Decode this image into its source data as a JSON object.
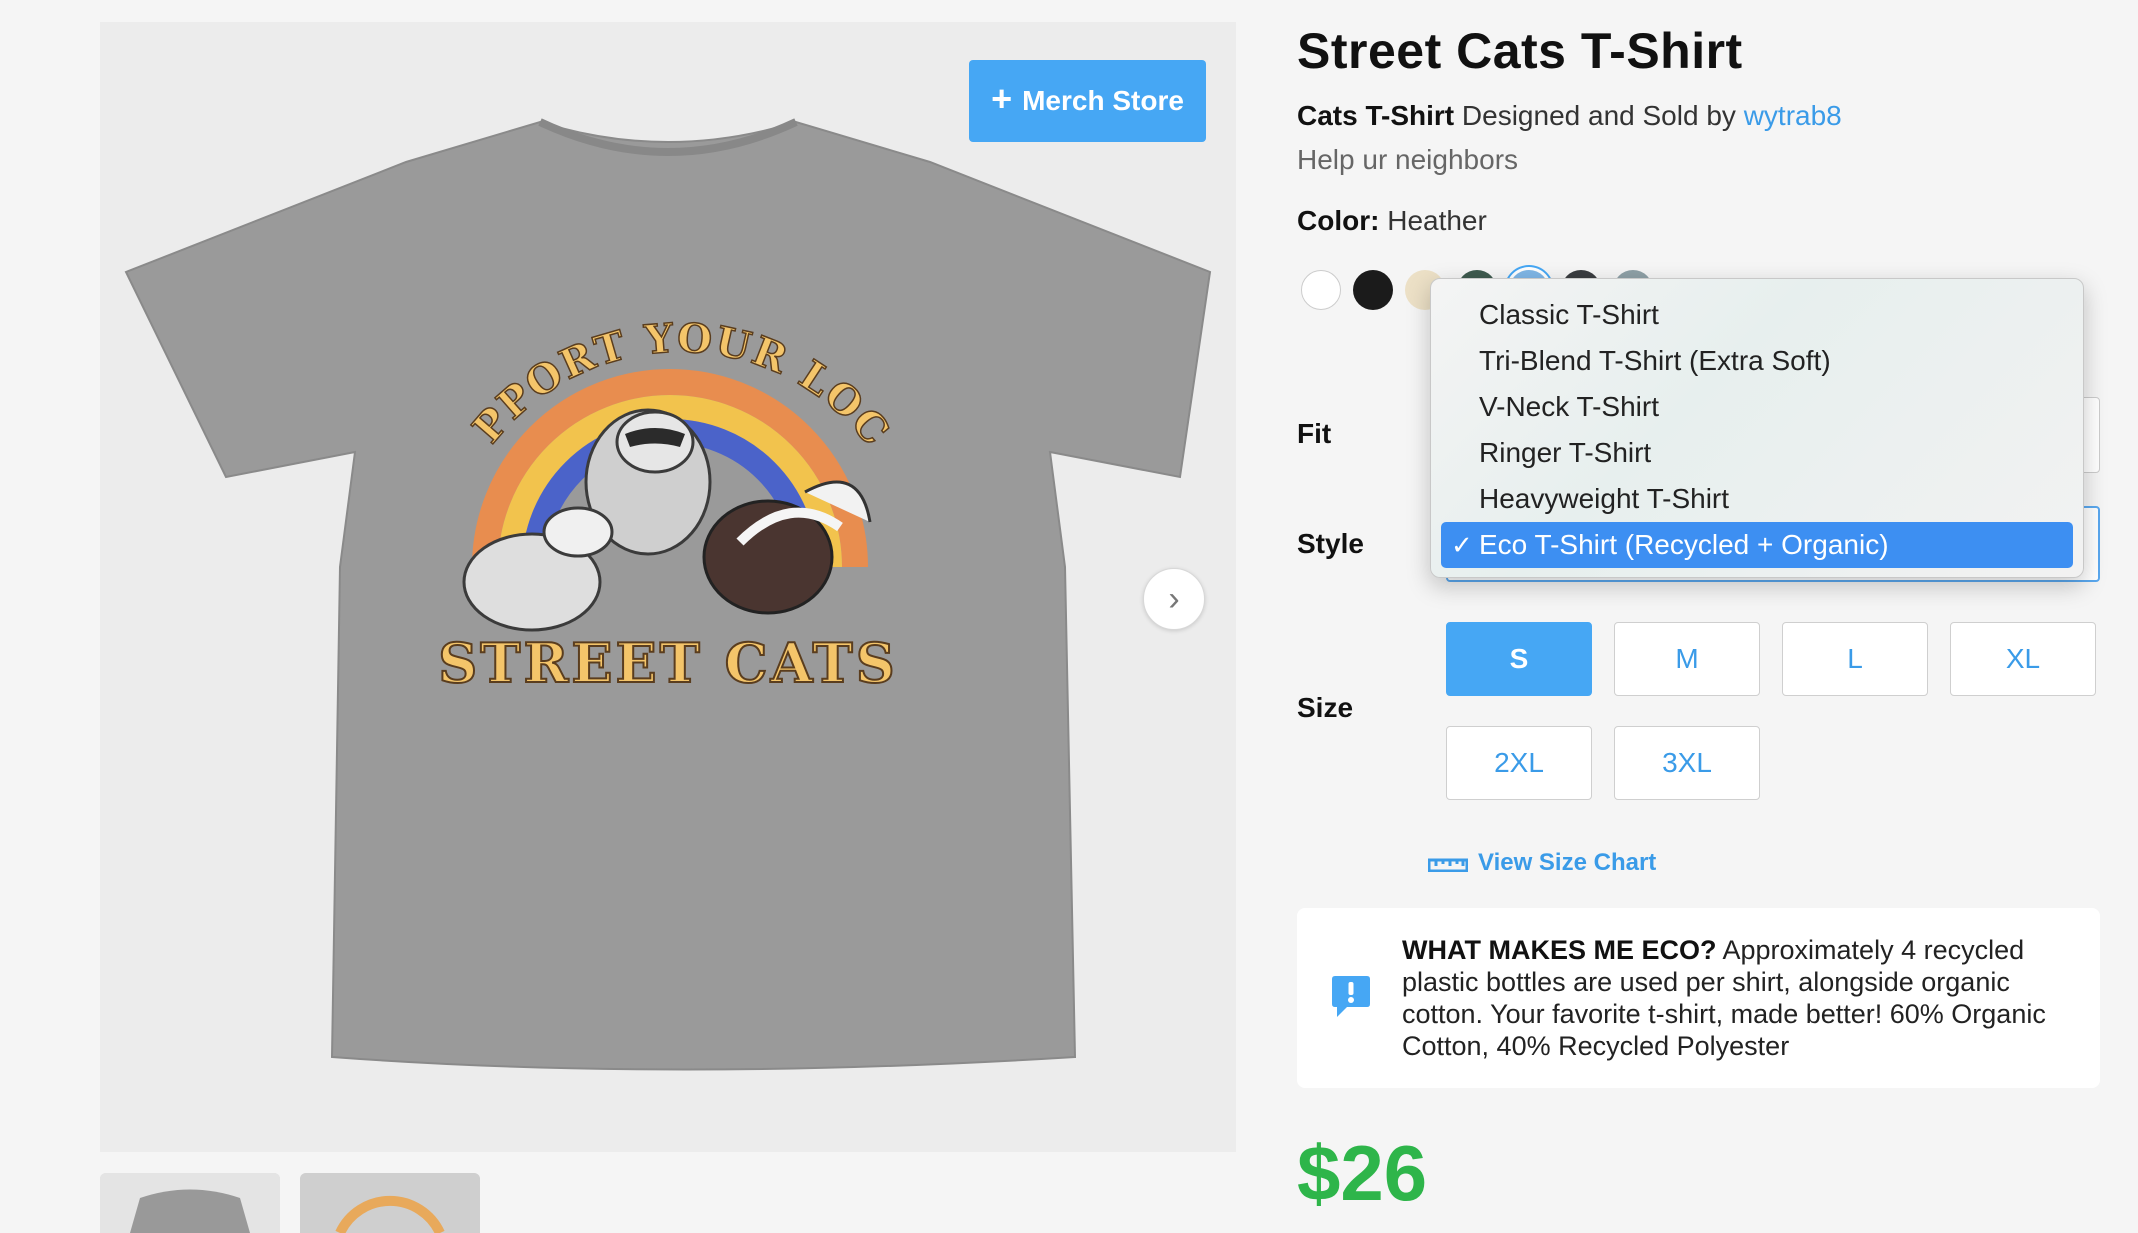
{
  "image_panel": {
    "merch_store_label": "Merch Store",
    "shirt_print": {
      "top_arc_text": "SUPPORT YOUR LOCAL",
      "bottom_text": "STREET CATS"
    }
  },
  "product": {
    "title": "Street Cats T-Shirt",
    "type_label": "Cats T-Shirt",
    "designed_sold_by": "Designed and Sold by",
    "designer": "wytrab8",
    "tagline": "Help ur neighbors",
    "color_label": "Color:",
    "color_value": "Heather"
  },
  "swatches": [
    {
      "name": "white",
      "color": "#ffffff"
    },
    {
      "name": "black",
      "color": "#1b1b1b"
    },
    {
      "name": "natural",
      "color": "#ece0c6"
    },
    {
      "name": "forest",
      "color": "#3e5a4e"
    },
    {
      "name": "heather-blue",
      "color": "#7fb6e6"
    },
    {
      "name": "dark-heather",
      "color": "#3a3d40"
    },
    {
      "name": "slate",
      "color": "#8ea0a6"
    }
  ],
  "fields": {
    "fit_label": "Fit",
    "style_label": "Style",
    "size_label": "Size"
  },
  "style_dropdown": {
    "options": [
      "Classic T-Shirt",
      "Tri-Blend T-Shirt (Extra Soft)",
      "V-Neck T-Shirt",
      "Ringer T-Shirt",
      "Heavyweight T-Shirt",
      "Eco T-Shirt (Recycled + Organic)"
    ],
    "selected": "Eco T-Shirt (Recycled + Organic)",
    "check_mark": "✓"
  },
  "sizes": [
    "S",
    "M",
    "L",
    "XL",
    "2XL",
    "3XL"
  ],
  "selected_size": "S",
  "size_chart_label": "View Size Chart",
  "eco": {
    "heading": "WHAT MAKES ME ECO?",
    "body": "Approximately 4 recycled plastic bottles are used per shirt, alongside organic cotton. Your favorite t-shirt, made better! 60% Organic Cotton, 40% Recycled Polyester"
  },
  "price": "$26",
  "colors": {
    "accent": "#46a7f4",
    "link": "#3a9be8",
    "price": "#2eb54a",
    "dropdown_selected": "#3d8ff2"
  }
}
